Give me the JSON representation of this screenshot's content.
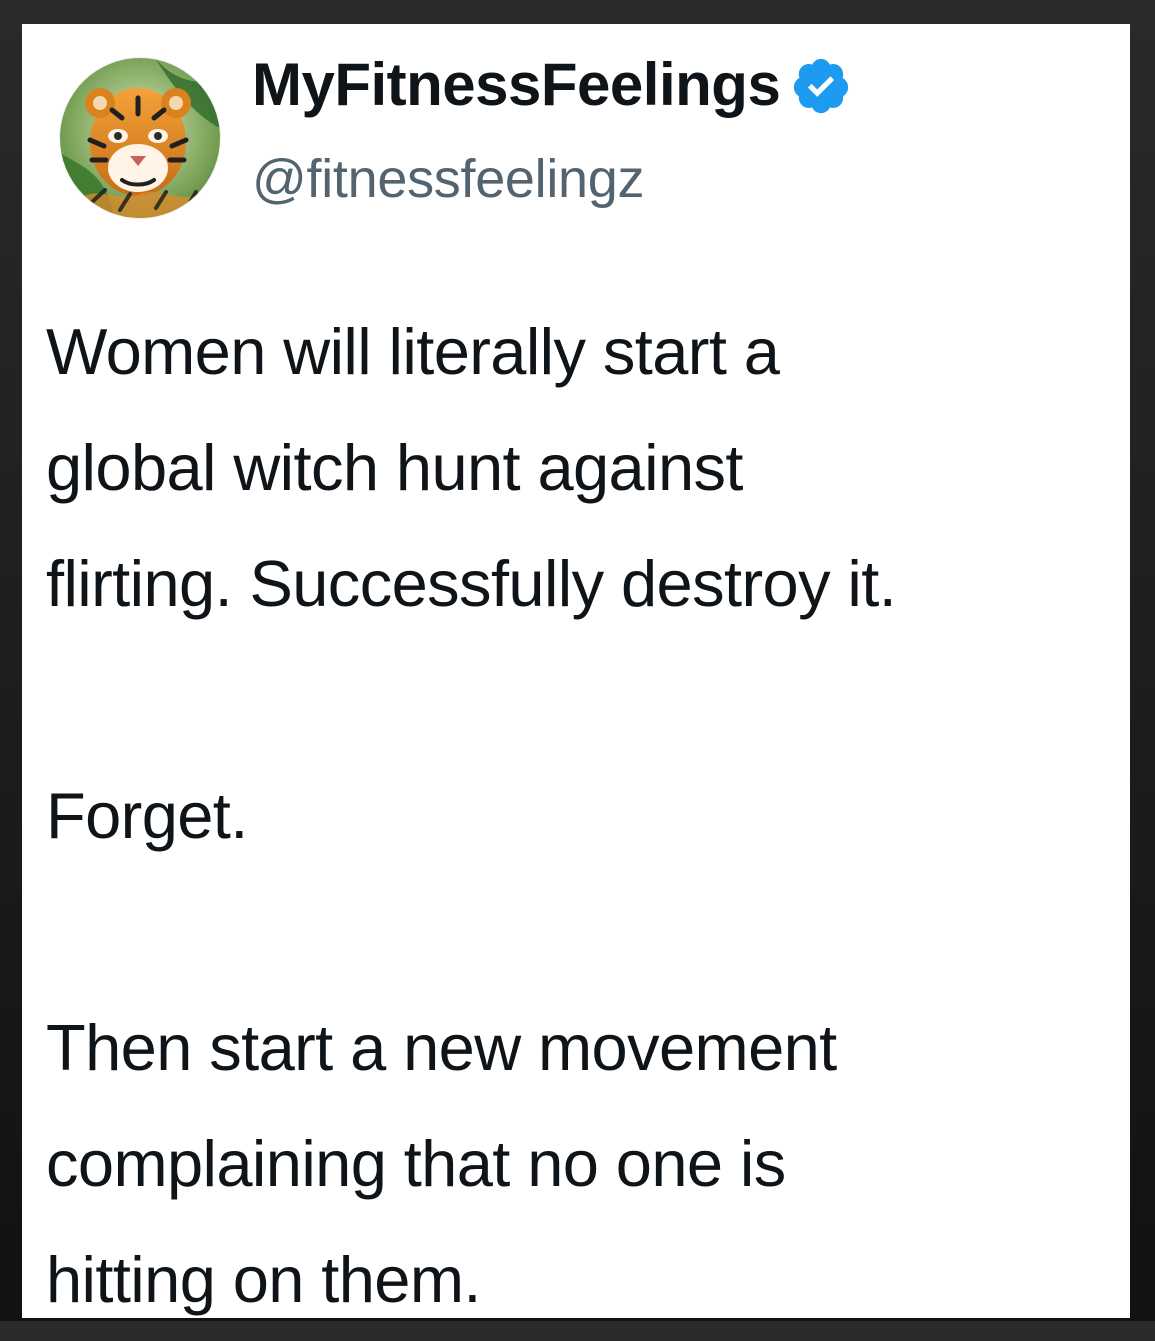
{
  "tweet": {
    "display_name": "MyFitnessFeelings",
    "handle": "@fitnessfeelingz",
    "verified": true,
    "avatar_icon": "tiger-avatar-icon",
    "verified_icon": "verified-badge-icon",
    "colors": {
      "verified": "#1d9bf0",
      "text": "#0f1419",
      "handle": "#536471"
    },
    "paragraphs": [
      {
        "lines": [
          "Women will literally start a",
          "global witch hunt against",
          "flirting. Successfully destroy it."
        ]
      },
      {
        "lines": [
          "Forget."
        ]
      },
      {
        "lines": [
          "Then start a new movement",
          "complaining that no one is",
          "hitting on them."
        ]
      }
    ]
  }
}
